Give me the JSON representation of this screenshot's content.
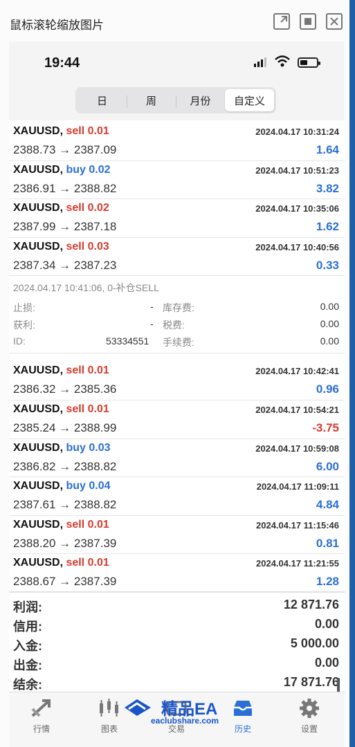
{
  "window": {
    "title": "鼠标滚轮缩放图片"
  },
  "status": {
    "time": "19:44"
  },
  "segments": [
    "日",
    "周",
    "月份",
    "自定义"
  ],
  "trades_top": [
    {
      "symbol": "XAUUSD,",
      "side": "sell 0.01",
      "type": "sell",
      "date": "2024.04.17 10:31:24",
      "prices": "2388.73 → 2387.09",
      "profit": "1.64",
      "sign": "pos"
    },
    {
      "symbol": "XAUUSD,",
      "side": "buy 0.02",
      "type": "buy",
      "date": "2024.04.17 10:51:23",
      "prices": "2386.91 → 2388.82",
      "profit": "3.82",
      "sign": "pos"
    },
    {
      "symbol": "XAUUSD,",
      "side": "sell 0.02",
      "type": "sell",
      "date": "2024.04.17 10:35:06",
      "prices": "2387.99 → 2387.18",
      "profit": "1.62",
      "sign": "pos"
    },
    {
      "symbol": "XAUUSD,",
      "side": "sell 0.03",
      "type": "sell",
      "date": "2024.04.17 10:40:56",
      "prices": "2387.34 → 2387.23",
      "profit": "0.33",
      "sign": "pos"
    }
  ],
  "detail": {
    "line": "2024.04.17 10:41:06, 0-补仓SELL",
    "stoploss_label": "止损:",
    "stoploss_value": "-",
    "takeprofit_label": "获利:",
    "takeprofit_value": "-",
    "id_label": "ID:",
    "id_value": "53334551",
    "swap_label": "库存费:",
    "swap_value": "0.00",
    "tax_label": "税费:",
    "tax_value": "0.00",
    "fee_label": "手续费:",
    "fee_value": "0.00"
  },
  "trades_bottom": [
    {
      "symbol": "XAUUSD,",
      "side": "sell 0.01",
      "type": "sell",
      "date": "2024.04.17 10:42:41",
      "prices": "2386.32 → 2385.36",
      "profit": "0.96",
      "sign": "pos"
    },
    {
      "symbol": "XAUUSD,",
      "side": "sell 0.01",
      "type": "sell",
      "date": "2024.04.17 10:54:21",
      "prices": "2385.24 → 2388.99",
      "profit": "-3.75",
      "sign": "neg"
    },
    {
      "symbol": "XAUUSD,",
      "side": "buy 0.03",
      "type": "buy",
      "date": "2024.04.17 10:59:08",
      "prices": "2386.82 → 2388.82",
      "profit": "6.00",
      "sign": "pos"
    },
    {
      "symbol": "XAUUSD,",
      "side": "buy 0.04",
      "type": "buy",
      "date": "2024.04.17 11:09:11",
      "prices": "2387.61 → 2388.82",
      "profit": "4.84",
      "sign": "pos"
    },
    {
      "symbol": "XAUUSD,",
      "side": "sell 0.01",
      "type": "sell",
      "date": "2024.04.17 11:15:46",
      "prices": "2388.20 → 2387.39",
      "profit": "0.81",
      "sign": "pos"
    },
    {
      "symbol": "XAUUSD,",
      "side": "sell 0.01",
      "type": "sell",
      "date": "2024.04.17 11:21:55",
      "prices": "2388.67 → 2387.39",
      "profit": "1.28",
      "sign": "pos"
    }
  ],
  "summary": [
    {
      "label": "利润:",
      "value": "12 871.76"
    },
    {
      "label": "信用:",
      "value": "0.00"
    },
    {
      "label": "入金:",
      "value": "5 000.00"
    },
    {
      "label": "出金:",
      "value": "0.00"
    },
    {
      "label": "结余:",
      "value": "17 871.76"
    }
  ],
  "tabs": [
    {
      "label": "行情",
      "icon": "trend-arrows-icon"
    },
    {
      "label": "图表",
      "icon": "candlestick-icon"
    },
    {
      "label": "交易",
      "icon": "trade-icon"
    },
    {
      "label": "历史",
      "icon": "inbox-icon",
      "active": true
    },
    {
      "label": "设置",
      "icon": "gear-icon"
    }
  ],
  "watermark": {
    "title": "精品EA",
    "subtitle": "eaclubshare.com"
  },
  "colors": {
    "sell": "#d83b2d",
    "buy": "#2b6fd6",
    "active_tab": "#2b6fd6"
  }
}
